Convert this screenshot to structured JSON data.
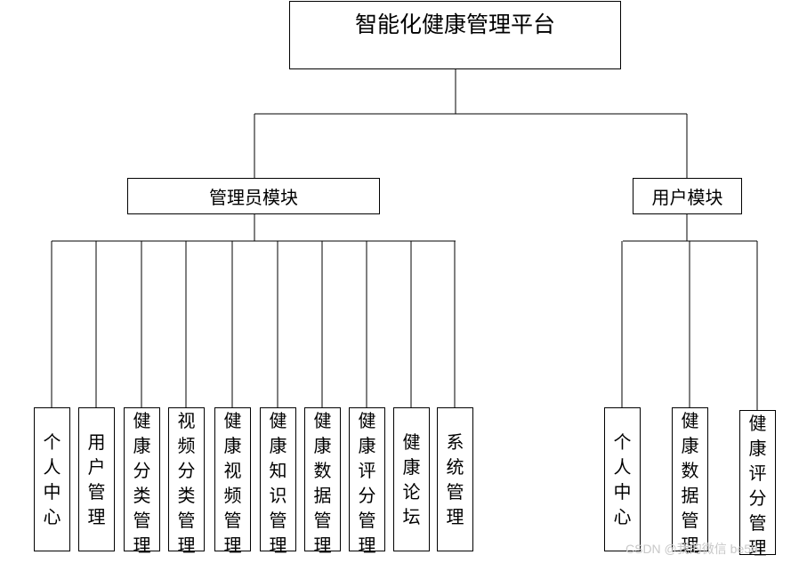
{
  "root": "智能化健康管理平台",
  "admin": {
    "label": "管理员模块",
    "children": [
      "个人中心",
      "用户管理",
      "健康分类管理",
      "视频分类管理",
      "健康视频管理",
      "健康知识管理",
      "健康数据管理",
      "健康评分管理",
      "健康论坛",
      "系统管理"
    ]
  },
  "user": {
    "label": "用户模块",
    "children": [
      "个人中心",
      "健康数据管理",
      "健康评分管理"
    ]
  },
  "watermark": "CSDN @我的微信  be58"
}
